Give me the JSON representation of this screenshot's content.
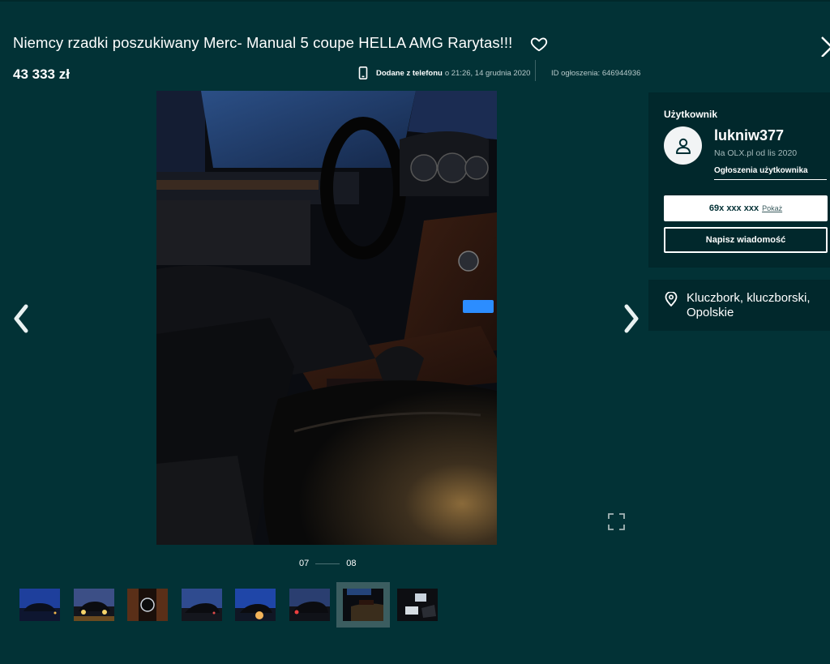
{
  "listing": {
    "title": "Niemcy rzadki poszukiwany Merc- Manual 5 coupe HELLA AMG Rarytas!!!",
    "price": "43 333 zł",
    "added_label": "Dodane z telefonu",
    "added_date": "o 21:26, 14 grudnia 2020",
    "ad_id": "ID ogłoszenia: 646944936"
  },
  "gallery": {
    "current": "07",
    "total": "08",
    "thumbnails": [
      "photo-1",
      "photo-2",
      "photo-3",
      "photo-4",
      "photo-5",
      "photo-6",
      "photo-7",
      "photo-8"
    ],
    "active_index": 6
  },
  "seller": {
    "section_label": "Użytkownik",
    "username": "lukniw377",
    "since": "Na OLX.pl od lis 2020",
    "user_ads_link": "Ogłoszenia użytkownika",
    "phone_masked": "69x xxx xxx",
    "show_phone": "Pokaż",
    "message_button": "Napisz wiadomość"
  },
  "location": {
    "text": "Kluczbork, kluczborski, Opolskie"
  },
  "icons": {
    "favorite": "heart-icon",
    "close": "close-icon",
    "phone": "phone-icon",
    "prev": "chevron-left-icon",
    "next": "chevron-right-icon",
    "fullscreen": "fullscreen-icon",
    "avatar": "user-icon",
    "location": "location-pin-icon"
  },
  "colors": {
    "background": "#023236",
    "card": "#01282c",
    "accent": "#ffffff"
  }
}
